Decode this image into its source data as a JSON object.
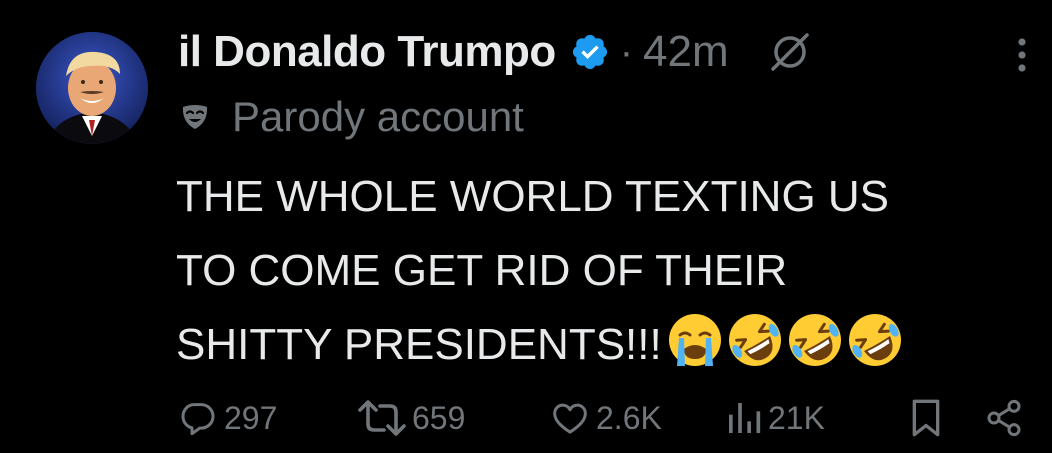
{
  "post": {
    "display_name": "il Donaldo Trumpo",
    "separator": "·",
    "time_ago": "42m",
    "label": "Parody account",
    "text_lines": [
      "THE WHOLE WORLD TEXTING US",
      "TO COME GET RID OF THEIR",
      "SHITTY PRESIDENTS!!!"
    ],
    "emojis": [
      "loudly-crying-face",
      "rolling-on-floor-laughing",
      "rolling-on-floor-laughing",
      "rolling-on-floor-laughing"
    ]
  },
  "actions": {
    "replies": "297",
    "reposts": "659",
    "likes": "2.6K",
    "views": "21K"
  },
  "colors": {
    "background": "#000000",
    "primary_text": "#e7e9ea",
    "secondary_text": "#71767b",
    "verified_blue": "#1d9bf0"
  },
  "icons": {
    "verified": "verified-badge-icon",
    "grok": "grok-icon",
    "more": "more-options-icon",
    "parody": "parody-mask-icon",
    "reply": "reply-icon",
    "repost": "repost-icon",
    "like": "heart-icon",
    "views": "views-icon",
    "bookmark": "bookmark-icon",
    "share": "share-icon"
  }
}
